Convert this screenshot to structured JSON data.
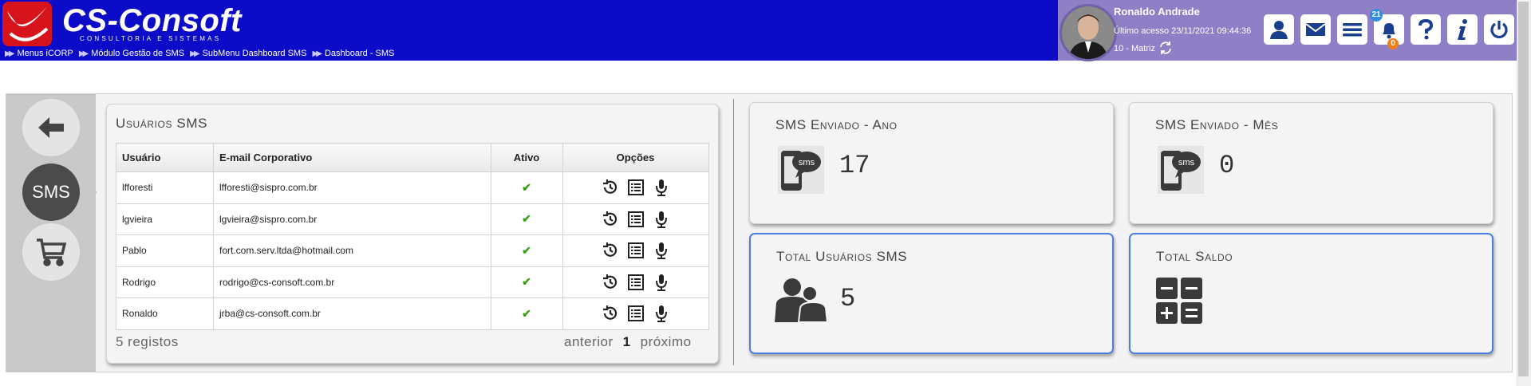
{
  "header": {
    "logo_title": "CS-Consoft",
    "logo_subtitle": "CONSULTORIA E SISTEMAS",
    "breadcrumb": [
      "Menus iCORP",
      "Módulo Gestão de SMS",
      "SubMenu Dashboard SMS",
      "Dashboard - SMS"
    ],
    "user_name": "Ronaldo Andrade",
    "last_access": "Último acesso 23/11/2021 09:44:36",
    "location": "10 - Matriz",
    "notifications_top": "21",
    "notifications_bottom": "0",
    "toolbar_icons": [
      "user-icon",
      "mail-icon",
      "menu-icon",
      "bell-icon",
      "help-icon",
      "info-icon",
      "power-icon"
    ],
    "colors": {
      "bar": "#0c0cc8",
      "user_area": "#8f7fc6",
      "logo_red": "#d7141b"
    }
  },
  "sidebar": {
    "items": [
      {
        "icon": "back-arrow-icon"
      },
      {
        "label": "SMS"
      },
      {
        "icon": "cart-icon"
      }
    ]
  },
  "users_card": {
    "title": "Usuários SMS",
    "columns": [
      "Usuário",
      "E-mail Corporativo",
      "Ativo",
      "Opções"
    ],
    "rows": [
      {
        "user": "lfforesti",
        "email": "lfforesti@sispro.com.br"
      },
      {
        "user": "lgvieira",
        "email": "lgvieira@sispro.com.br"
      },
      {
        "user": "Pablo",
        "email": "fort.com.serv.ltda@hotmail.com"
      },
      {
        "user": "Rodrigo",
        "email": "rodrigo@cs-consoft.com.br"
      },
      {
        "user": "Ronaldo",
        "email": "jrba@cs-consoft.com.br"
      }
    ],
    "check": "✔",
    "option_icons": [
      "history-icon",
      "list-icon",
      "microphone-icon"
    ],
    "record_count": "5 registos",
    "pager": {
      "prev": "anterior",
      "current": "1",
      "next": "próximo"
    }
  },
  "stats": {
    "sms_year": {
      "title": "SMS Enviado - Ano",
      "value": "17"
    },
    "sms_month": {
      "title": "SMS Enviado - Mês",
      "value": "0"
    },
    "total_users": {
      "title": "Total Usuários SMS",
      "value": "5"
    },
    "total_balance": {
      "title": "Total Saldo"
    },
    "sms_icon_text": "sms",
    "highlight_color": "#4e7fe0"
  }
}
